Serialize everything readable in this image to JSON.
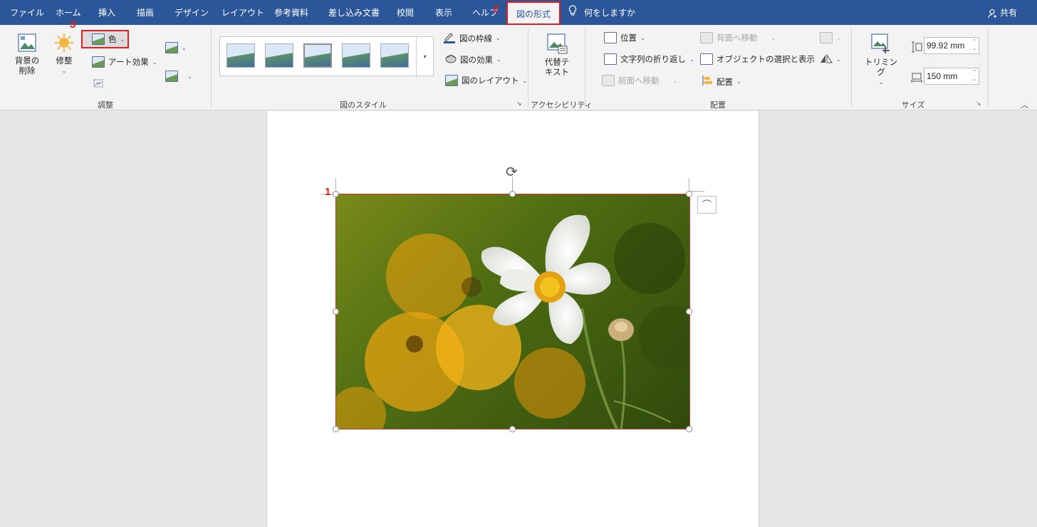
{
  "tabs": [
    {
      "label": "ファイル"
    },
    {
      "label": "ホーム"
    },
    {
      "label": "挿入"
    },
    {
      "label": "描画"
    },
    {
      "label": "デザイン"
    },
    {
      "label": "レイアウト"
    },
    {
      "label": "参考資料"
    },
    {
      "label": "差し込み文書"
    },
    {
      "label": "校閲"
    },
    {
      "label": "表示"
    },
    {
      "label": "ヘルプ"
    },
    {
      "label": "図の形式"
    }
  ],
  "tell_me": "何をしますか",
  "share": "共有",
  "markers": {
    "m1": "1",
    "m2": "2",
    "m3": "3"
  },
  "adjust": {
    "remove_bg": "背景の\n削除",
    "corrections": "修整",
    "color": "色",
    "artistic": "アート効果",
    "group_label": "調整"
  },
  "styles": {
    "border": "図の枠線",
    "effects": "図の効果",
    "layout": "図のレイアウト",
    "group_label": "図のスタイル"
  },
  "accessibility": {
    "alt_text": "代替テ\nキスト",
    "group_label": "アクセシビリティ"
  },
  "arrange": {
    "position": "位置",
    "wrap_text": "文字列の折り返し",
    "bring_forward": "前面へ移動",
    "send_backward": "背面へ移動",
    "selection_pane": "オブジェクトの選択と表示",
    "align": "配置",
    "group_label": "配置"
  },
  "size": {
    "crop": "トリミング",
    "height": "99.92 mm",
    "width": "150 mm",
    "group_label": "サイズ"
  },
  "colors": {
    "accent": "#2b579a",
    "highlight": "#e02020",
    "selection": "#d9322c"
  }
}
